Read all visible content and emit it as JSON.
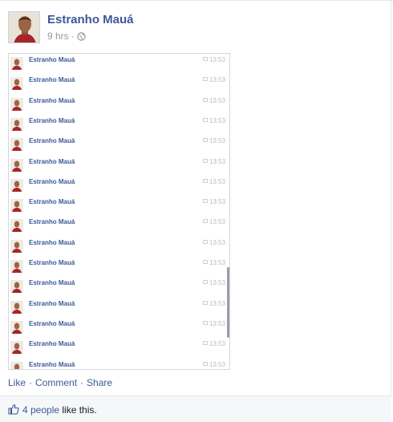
{
  "post": {
    "author": "Estranho Mauá",
    "time": "9 hrs",
    "separator": "·",
    "privacy_icon": "globe-icon"
  },
  "screenshot": {
    "rows": [
      {
        "name": "Estranho Mauá",
        "time": "13:53"
      },
      {
        "name": "Estranho Mauá",
        "time": "13:53"
      },
      {
        "name": "Estranho Mauá",
        "time": "13:53"
      },
      {
        "name": "Estranho Mauá",
        "time": "13:53"
      },
      {
        "name": "Estranho Mauá",
        "time": "13:53"
      },
      {
        "name": "Estranho Mauá",
        "time": "13:53"
      },
      {
        "name": "Estranho Mauá",
        "time": "13:53"
      },
      {
        "name": "Estranho Mauá",
        "time": "13:53"
      },
      {
        "name": "Estranho Mauá",
        "time": "13:53"
      },
      {
        "name": "Estranho Mauá",
        "time": "13:53"
      },
      {
        "name": "Estranho Mauá",
        "time": "13:53"
      },
      {
        "name": "Estranho Mauá",
        "time": "13:53"
      },
      {
        "name": "Estranho Mauá",
        "time": "13:53"
      },
      {
        "name": "Estranho Mauá",
        "time": "13:53"
      },
      {
        "name": "Estranho Mauá",
        "time": "13:53"
      },
      {
        "name": "Estranho Mauá",
        "time": "13:53"
      }
    ]
  },
  "actions": {
    "like": "Like",
    "comment": "Comment",
    "share": "Share",
    "separator": "·"
  },
  "likes": {
    "people": "4 people",
    "suffix": " like this."
  },
  "colors": {
    "link": "#3b5998",
    "muted": "#9197a3",
    "likes_bg": "#f6f7f8"
  }
}
